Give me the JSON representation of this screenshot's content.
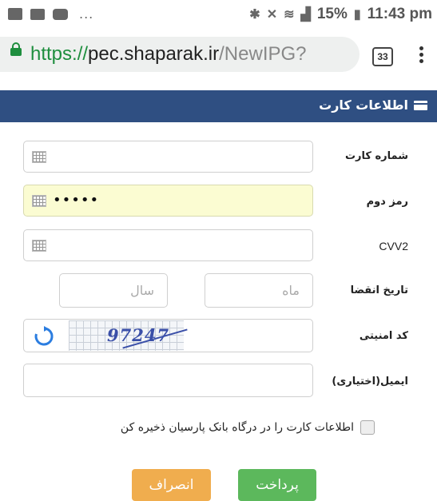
{
  "status_bar": {
    "dots": "...",
    "battery": "15%",
    "time": "11:43 pm"
  },
  "browser": {
    "url_scheme": "https://",
    "url_host": "pec.shaparak.ir",
    "url_path": "/NewIPG?",
    "tab_count": "33"
  },
  "header": {
    "title": "اطلاعات کارت"
  },
  "form": {
    "card_number_label": "شماره کارت",
    "second_password_label": "رمز دوم",
    "second_password_value": "•••••",
    "cvv2_label": "CVV2",
    "expiry_label": "تاریخ انقضا",
    "month_placeholder": "ماه",
    "year_placeholder": "سال",
    "security_code_label": "کد امنیتی",
    "captcha_text": "97247",
    "email_label": "ایمیل(اختیاری)",
    "save_card_label": "اطلاعات کارت را در درگاه بانک پارسیان ذخیره کن"
  },
  "buttons": {
    "pay": "پرداخت",
    "cancel": "انصراف"
  },
  "colors": {
    "header": "#2f4f82",
    "pay": "#5cb85c",
    "cancel": "#f0ad4e",
    "highlight": "#fbfcd2",
    "secure": "#1e8e3e"
  }
}
